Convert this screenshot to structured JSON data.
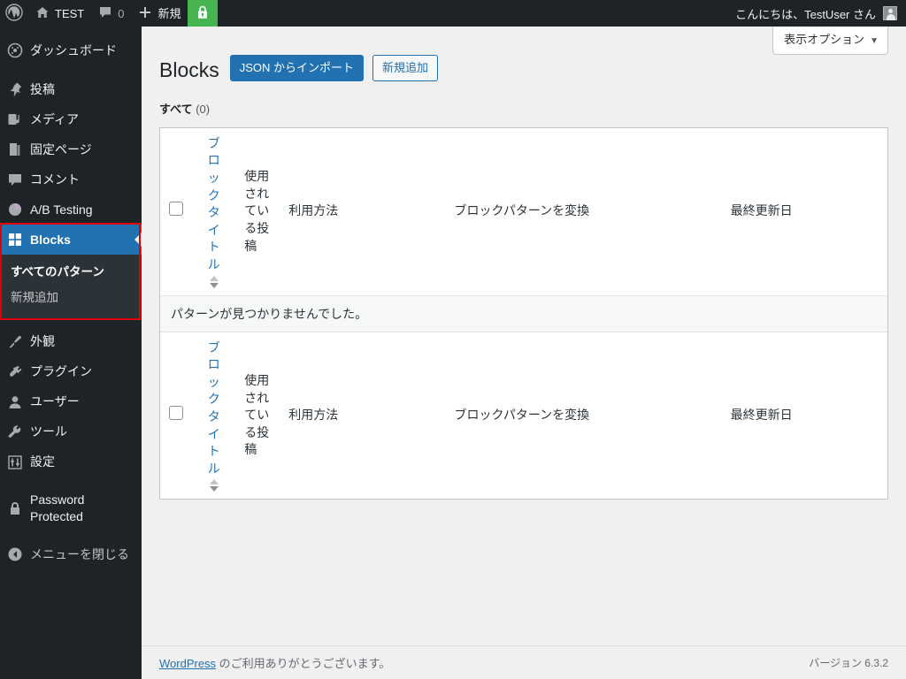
{
  "adminbar": {
    "wp_logo_icon": "wordpress-logo-icon",
    "site_name": "TEST",
    "site_icon": "home-icon",
    "comments_icon": "comment-bubble-icon",
    "comments_count": "0",
    "new_icon": "plus-icon",
    "new_label": "新規",
    "lock_icon": "padlock-icon",
    "greeting": "こんにちは、TestUser さん",
    "avatar_icon": "user-avatar-icon"
  },
  "sidebar": {
    "items": [
      {
        "label": "ダッシュボード",
        "icon": "dashboard-icon"
      },
      {
        "label": "投稿",
        "icon": "pushpin-icon"
      },
      {
        "label": "メディア",
        "icon": "media-icon"
      },
      {
        "label": "固定ページ",
        "icon": "pages-icon"
      },
      {
        "label": "コメント",
        "icon": "comment-bubble-icon"
      },
      {
        "label": "A/B Testing",
        "icon": "pie-chart-icon"
      },
      {
        "label": "Blocks",
        "icon": "blocks-grid-icon"
      },
      {
        "label": "外観",
        "icon": "paintbrush-icon"
      },
      {
        "label": "プラグイン",
        "icon": "plug-icon"
      },
      {
        "label": "ユーザー",
        "icon": "user-icon"
      },
      {
        "label": "ツール",
        "icon": "wrench-icon"
      },
      {
        "label": "設定",
        "icon": "sliders-icon"
      },
      {
        "label": "Password Protected",
        "icon": "padlock-icon"
      }
    ],
    "blocks_submenu": [
      {
        "label": "すべてのパターン"
      },
      {
        "label": "新規追加"
      }
    ],
    "collapse": {
      "label": "メニューを閉じる",
      "icon": "collapse-arrow-icon"
    },
    "annotation_color": "#e00000",
    "current_color": "#2271b1"
  },
  "screen_meta": {
    "screen_options_label": "表示オプション",
    "caret_icon": "chevron-down-icon"
  },
  "page": {
    "title": "Blocks",
    "import_button": "JSON からインポート",
    "add_new_button": "新規追加",
    "filter_all_label": "すべて",
    "filter_all_count": "(0)"
  },
  "table": {
    "columns": {
      "checkbox": "select-all",
      "title": "ブロックタイトル",
      "posts": "使用されている投稿",
      "usage": "利用方法",
      "convert": "ブロックパターンを変換",
      "date": "最終更新日"
    },
    "sort_icons": {
      "asc": "sort-ascending-icon",
      "desc": "sort-descending-icon"
    },
    "empty_message": "パターンが見つかりませんでした。"
  },
  "footer": {
    "thanks_link": "WordPress",
    "thanks_rest": " のご利用ありがとうございます。",
    "version": "バージョン 6.3.2"
  }
}
